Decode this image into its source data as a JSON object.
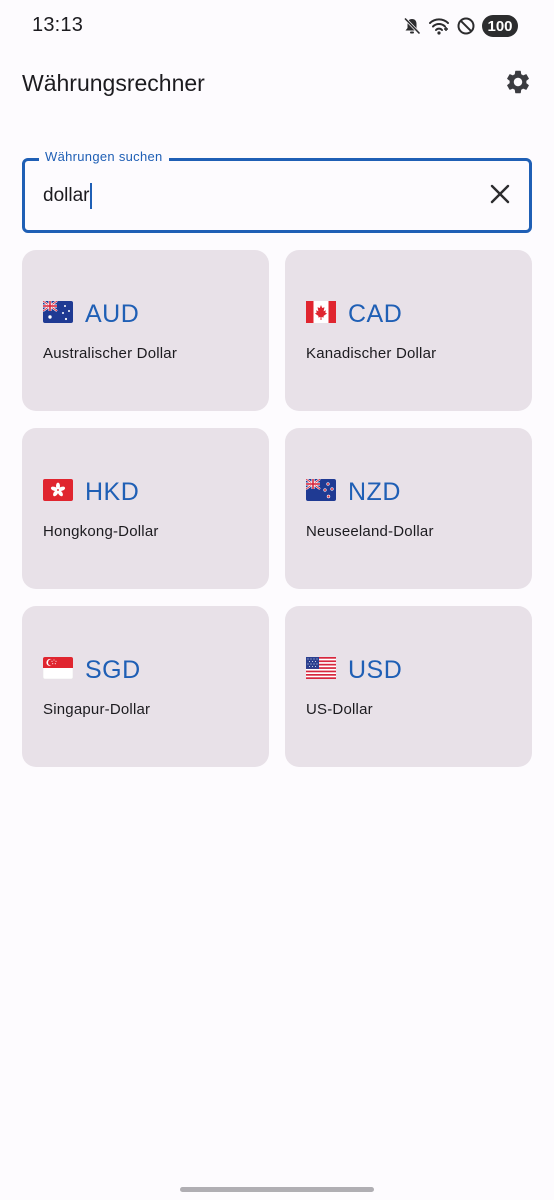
{
  "status": {
    "time": "13:13",
    "battery": "100",
    "icons": [
      "mute-icon",
      "wifi-icon",
      "do-not-disturb-icon"
    ]
  },
  "app": {
    "title": "Währungsrechner",
    "settings_icon": "gear-icon"
  },
  "search": {
    "label": "Währungen suchen",
    "value": "dollar",
    "clear_icon": "close-icon"
  },
  "currencies": [
    {
      "code": "AUD",
      "name": "Australischer Dollar",
      "flag": "australia-flag-icon"
    },
    {
      "code": "CAD",
      "name": "Kanadischer Dollar",
      "flag": "canada-flag-icon"
    },
    {
      "code": "HKD",
      "name": "Hongkong-Dollar",
      "flag": "hong-kong-flag-icon"
    },
    {
      "code": "NZD",
      "name": "Neuseeland-Dollar",
      "flag": "new-zealand-flag-icon"
    },
    {
      "code": "SGD",
      "name": "Singapur-Dollar",
      "flag": "singapore-flag-icon"
    },
    {
      "code": "USD",
      "name": "US-Dollar",
      "flag": "usa-flag-icon"
    }
  ],
  "colors": {
    "accent": "#1f5fb5",
    "card_background": "#e8e1e8",
    "page_background": "#fdfbfe"
  }
}
